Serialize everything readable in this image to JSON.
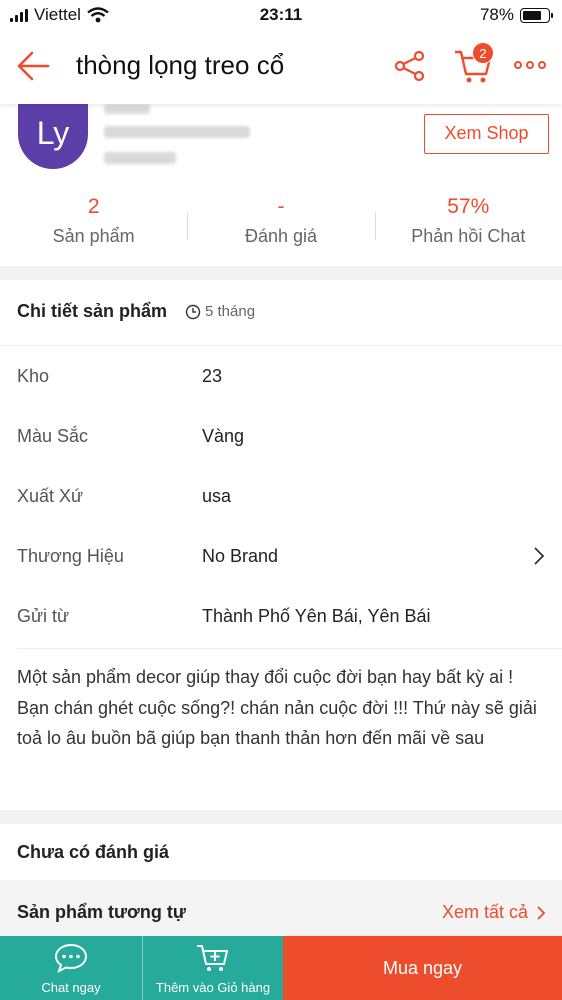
{
  "status_bar": {
    "carrier": "Viettel",
    "time": "23:11",
    "battery": "78%",
    "battery_level": 0.78
  },
  "header": {
    "title": "thòng lọng treo cổ",
    "cart_count": "2"
  },
  "shop": {
    "avatar_initials": "Ly",
    "view_shop_label": "Xem Shop",
    "stats": [
      {
        "value": "2",
        "label": "Sản phẩm"
      },
      {
        "value": "-",
        "label": "Đánh giá"
      },
      {
        "value": "57%",
        "label": "Phản hồi Chat"
      }
    ]
  },
  "details": {
    "heading": "Chi tiết sản phẩm",
    "age": "5 tháng",
    "rows": [
      {
        "key": "Kho",
        "value": "23"
      },
      {
        "key": "Màu Sắc",
        "value": "Vàng"
      },
      {
        "key": "Xuất Xứ",
        "value": "usa"
      },
      {
        "key": "Thương Hiệu",
        "value": "No Brand"
      },
      {
        "key": "Gửi từ",
        "value": "Thành Phố Yên Bái, Yên Bái"
      }
    ],
    "description": "Một sản phẩm decor giúp thay đổi cuộc đời bạn hay bất kỳ ai ! Bạn chán ghét cuộc sống?! chán nản cuộc đời !!! Thứ này sẽ giải toả lo âu buồn bã giúp bạn thanh thản hơn đến mãi về sau"
  },
  "reviews": {
    "heading": "Chưa có đánh giá"
  },
  "similar": {
    "heading": "Sản phẩm tương tự",
    "see_all": "Xem tất cả"
  },
  "bottom_bar": {
    "chat_label": "Chat ngay",
    "add_to_cart_label": "Thêm vào Giỏ hàng",
    "buy_now_label": "Mua ngay"
  },
  "colors": {
    "accent": "#ee4d2d",
    "teal": "#26aa99",
    "avatar": "#5b3ea8"
  }
}
